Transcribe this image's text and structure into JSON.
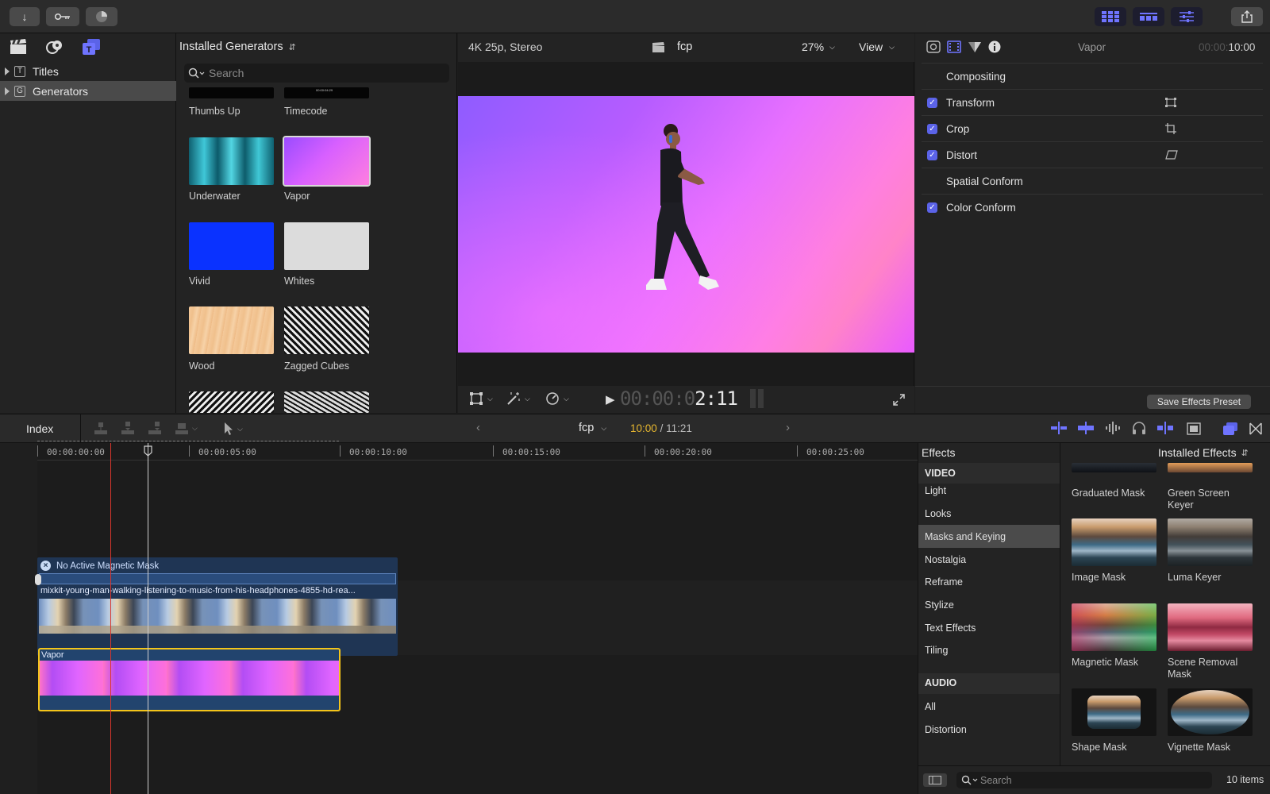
{
  "toolbar": {
    "import_icon": "arrow-down-icon",
    "keywords_icon": "key-icon",
    "background_tasks_icon": "progress-icon",
    "share_icon": "share-icon"
  },
  "library": {
    "items": [
      {
        "label": "Titles",
        "icon": "T"
      },
      {
        "label": "Generators",
        "icon": "G"
      }
    ]
  },
  "browser": {
    "title": "Installed Generators",
    "search_placeholder": "Search",
    "timecode_thumb_text": "00:00:04:29",
    "items": [
      {
        "label": "Thumbs Up"
      },
      {
        "label": "Timecode"
      },
      {
        "label": "Underwater"
      },
      {
        "label": "Vapor"
      },
      {
        "label": "Vivid"
      },
      {
        "label": "Whites"
      },
      {
        "label": "Wood"
      },
      {
        "label": "Zagged Cubes"
      }
    ]
  },
  "viewer": {
    "format": "4K 25p, Stereo",
    "project": "fcp",
    "zoom": "27%",
    "view_label": "View",
    "timecode_dim": "00:00:0",
    "timecode_bright": "2:11"
  },
  "inspector": {
    "title": "Vapor",
    "duration_dim": "00:00:",
    "duration_bright": "10:00",
    "rows": [
      {
        "label": "Compositing",
        "checked": false
      },
      {
        "label": "Transform",
        "checked": true
      },
      {
        "label": "Crop",
        "checked": true
      },
      {
        "label": "Distort",
        "checked": true
      },
      {
        "label": "Spatial Conform",
        "checked": false
      },
      {
        "label": "Color Conform",
        "checked": true
      }
    ],
    "save_preset_label": "Save Effects Preset"
  },
  "timeline_bar": {
    "index_label": "Index",
    "project": "fcp",
    "position": "10:00",
    "duration": "/ 11:21"
  },
  "timeline": {
    "ruler": [
      "00:00:00:00",
      "00:00:05:00",
      "00:00:10:00",
      "00:00:15:00",
      "00:00:20:00",
      "00:00:25:00"
    ],
    "mask_label": "No Active Magnetic Mask",
    "clip_name": "mixkit-young-man-walking-listening-to-music-from-his-headphones-4855-hd-rea...",
    "generator_clip_name": "Vapor"
  },
  "effects": {
    "header": "Effects",
    "source": "Installed Effects",
    "video_section": "VIDEO",
    "categories": [
      "Light",
      "Looks",
      "Masks and Keying",
      "Nostalgia",
      "Reframe",
      "Stylize",
      "Text Effects",
      "Tiling"
    ],
    "selected_category": "Masks and Keying",
    "audio_section": "AUDIO",
    "audio_categories": [
      "All",
      "Distortion"
    ],
    "items": [
      {
        "label": "Graduated Mask"
      },
      {
        "label": "Green Screen Keyer"
      },
      {
        "label": "Image Mask"
      },
      {
        "label": "Luma Keyer"
      },
      {
        "label": "Magnetic Mask"
      },
      {
        "label": "Scene Removal Mask"
      },
      {
        "label": "Shape Mask"
      },
      {
        "label": "Vignette Mask"
      }
    ],
    "search_placeholder": "Search",
    "count": "10 items"
  }
}
